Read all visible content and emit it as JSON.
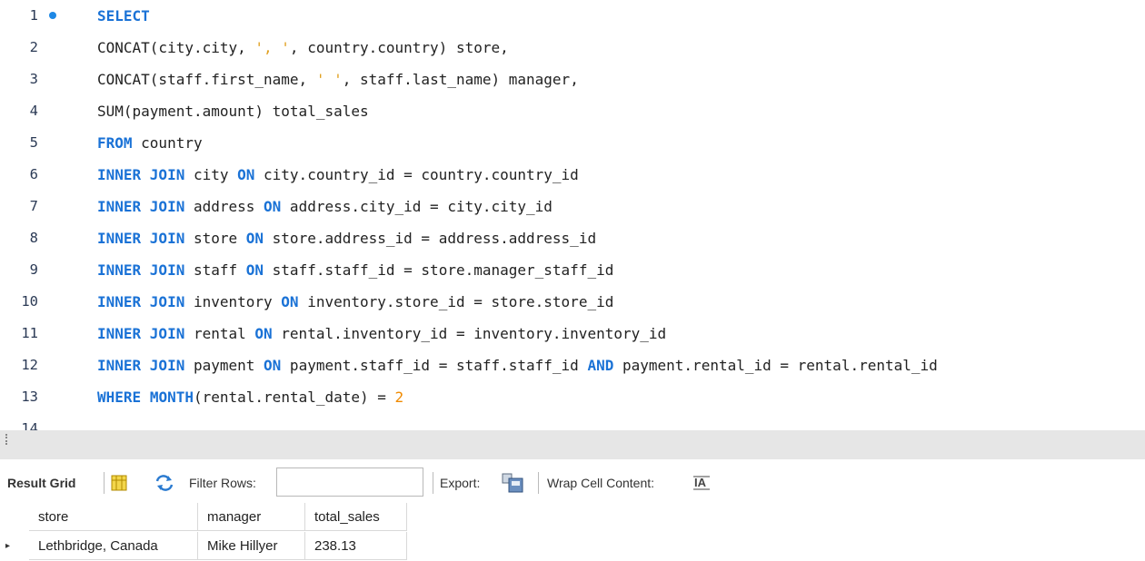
{
  "editor": {
    "lines": [
      {
        "num": "1",
        "bullet": true,
        "tokens": [
          {
            "t": "SELECT",
            "c": "kw"
          }
        ]
      },
      {
        "num": "2",
        "tokens": [
          {
            "t": "CONCAT(city.city, "
          },
          {
            "t": "', '",
            "c": "str"
          },
          {
            "t": ", country.country) store,"
          }
        ]
      },
      {
        "num": "3",
        "tokens": [
          {
            "t": "CONCAT(staff.first_name, "
          },
          {
            "t": "' '",
            "c": "str"
          },
          {
            "t": ", staff.last_name) manager,"
          }
        ]
      },
      {
        "num": "4",
        "tokens": [
          {
            "t": "SUM(payment.amount) total_sales"
          }
        ]
      },
      {
        "num": "5",
        "tokens": [
          {
            "t": "FROM",
            "c": "kw"
          },
          {
            "t": " country"
          }
        ]
      },
      {
        "num": "6",
        "tokens": [
          {
            "t": "INNER JOIN",
            "c": "kw"
          },
          {
            "t": " city "
          },
          {
            "t": "ON",
            "c": "kw"
          },
          {
            "t": " city.country_id = country.country_id"
          }
        ]
      },
      {
        "num": "7",
        "tokens": [
          {
            "t": "INNER JOIN",
            "c": "kw"
          },
          {
            "t": " address "
          },
          {
            "t": "ON",
            "c": "kw"
          },
          {
            "t": " address.city_id = city.city_id"
          }
        ]
      },
      {
        "num": "8",
        "tokens": [
          {
            "t": "INNER JOIN",
            "c": "kw"
          },
          {
            "t": " store "
          },
          {
            "t": "ON",
            "c": "kw"
          },
          {
            "t": " store.address_id = address.address_id"
          }
        ]
      },
      {
        "num": "9",
        "tokens": [
          {
            "t": "INNER JOIN",
            "c": "kw"
          },
          {
            "t": " staff "
          },
          {
            "t": "ON",
            "c": "kw"
          },
          {
            "t": " staff.staff_id = store.manager_staff_id"
          }
        ]
      },
      {
        "num": "10",
        "tokens": [
          {
            "t": "INNER JOIN",
            "c": "kw"
          },
          {
            "t": " inventory "
          },
          {
            "t": "ON",
            "c": "kw"
          },
          {
            "t": " inventory.store_id = store.store_id"
          }
        ]
      },
      {
        "num": "11",
        "tokens": [
          {
            "t": "INNER JOIN",
            "c": "kw"
          },
          {
            "t": " rental "
          },
          {
            "t": "ON",
            "c": "kw"
          },
          {
            "t": " rental.inventory_id = inventory.inventory_id"
          }
        ]
      },
      {
        "num": "12",
        "tokens": [
          {
            "t": "INNER JOIN",
            "c": "kw"
          },
          {
            "t": " payment "
          },
          {
            "t": "ON",
            "c": "kw"
          },
          {
            "t": " payment.staff_id = staff.staff_id "
          },
          {
            "t": "AND",
            "c": "kw"
          },
          {
            "t": " payment.rental_id = rental.rental_id"
          }
        ]
      },
      {
        "num": "13",
        "tokens": [
          {
            "t": "WHERE",
            "c": "kw"
          },
          {
            "t": " "
          },
          {
            "t": "MONTH",
            "c": "kw"
          },
          {
            "t": "(rental.rental_date) = "
          },
          {
            "t": "2",
            "c": "num"
          }
        ]
      },
      {
        "num": "14",
        "tokens": []
      }
    ]
  },
  "toolbar": {
    "result_grid_label": "Result Grid",
    "filter_label": "Filter Rows:",
    "filter_value": "",
    "export_label": "Export:",
    "wrap_label": "Wrap Cell Content:",
    "icons": [
      "grid-layout-icon",
      "refresh-icon",
      "export-icon",
      "wrap-text-icon"
    ]
  },
  "grid": {
    "columns": [
      "store",
      "manager",
      "total_sales"
    ],
    "rows": [
      [
        "Lethbridge, Canada",
        "Mike Hillyer",
        "238.13"
      ]
    ]
  },
  "colors": {
    "keyword": "#1a72d6",
    "string": "#e0a020",
    "number": "#f08a00",
    "bullet": "#1e88e5"
  }
}
